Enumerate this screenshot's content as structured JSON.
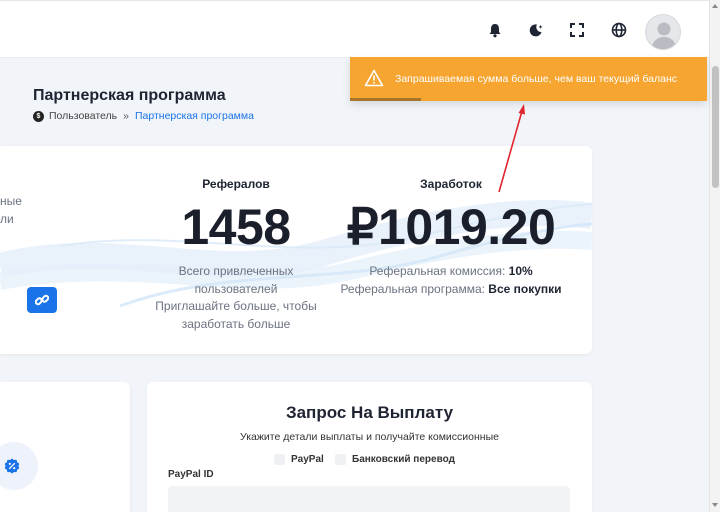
{
  "page": {
    "title": "Партнерская программа",
    "breadcrumb": {
      "home_icon": "dollar-icon",
      "root": "Пользователь",
      "separator": "»",
      "current": "Партнерская программа"
    }
  },
  "topbar": {
    "icons": [
      "bell-icon",
      "moon-icon",
      "fullscreen-icon",
      "globe-icon"
    ],
    "avatar": "user-avatar"
  },
  "toast": {
    "message": "Запрашиваемая сумма больше, чем ваш текущий баланс",
    "icon": "warning-icon",
    "progress": 0.2,
    "color": "#f6a531"
  },
  "stats": {
    "left_cut": {
      "line1": "ные",
      "line2": "ли"
    },
    "referrals": {
      "label": "Рефералов",
      "value": "1458",
      "desc_line1": "Всего привлеченных",
      "desc_line2": "пользователей",
      "desc_line3": "Приглашайте больше, чтобы",
      "desc_line4": "заработать больше"
    },
    "earnings": {
      "label": "Заработок",
      "value": "₽1019.20",
      "commission_label": "Реферальная комиссия:",
      "commission_value": "10%",
      "program_label": "Реферальная программа:",
      "program_value": "Все покупки"
    }
  },
  "payout": {
    "title": "Запрос На Выплату",
    "subtitle": "Укажите детали выплаты и получайте комиссионные",
    "methods": [
      "PayPal",
      "Банковский перевод"
    ],
    "field_label": "PayPal ID",
    "field_value": ""
  },
  "colors": {
    "accent": "#1a73e8",
    "warning": "#f6a531",
    "annotation": "#e0262e"
  }
}
